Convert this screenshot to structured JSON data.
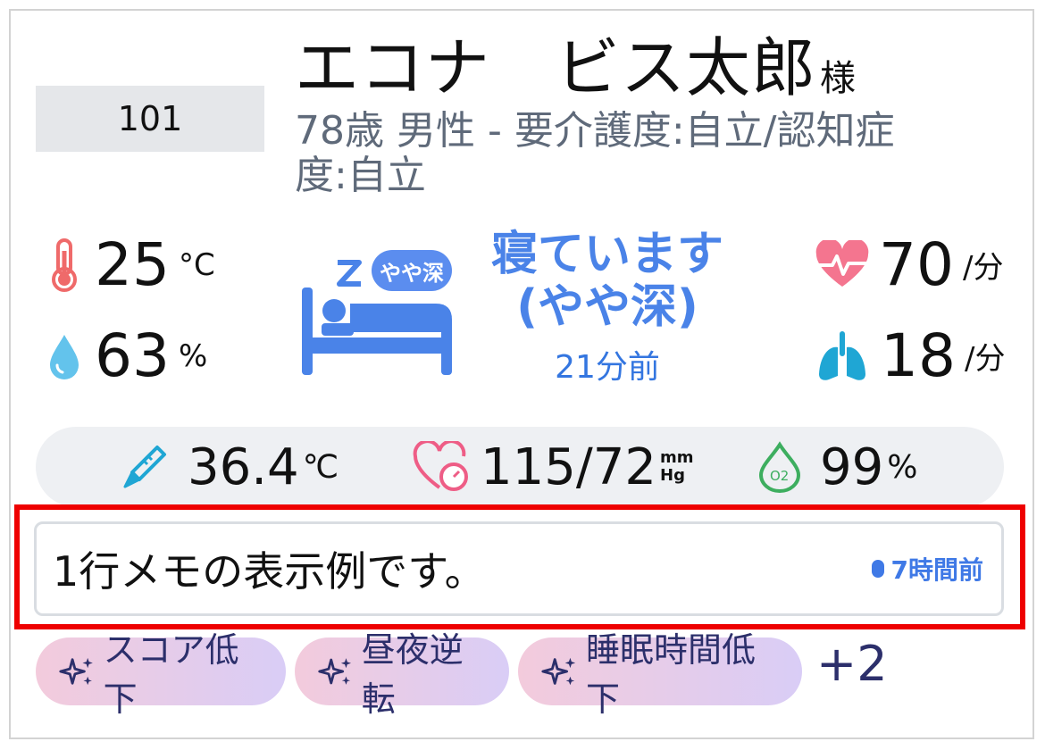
{
  "resident": {
    "room_number": "101",
    "name": "エコナ　ビス太郎",
    "honorific": "様",
    "info_line1": "78歳 男性 - 要介護度:自立/認知症",
    "info_line2": "度:自立"
  },
  "environment": {
    "temperature": {
      "value": "25",
      "unit": "°C",
      "icon": "thermometer-icon"
    },
    "humidity": {
      "value": "63",
      "unit": "%",
      "icon": "water-drop-icon"
    },
    "heart_rate": {
      "value": "70",
      "unit": "/分",
      "icon": "heart-pulse-icon"
    },
    "respiration": {
      "value": "18",
      "unit": "/分",
      "icon": "lungs-icon"
    }
  },
  "sleep": {
    "badge": "やや深",
    "status_line1": "寝ています",
    "status_line2": "(やや深)",
    "elapsed": "21分前",
    "icon": "bed-sleeping-icon",
    "color": "#4a83e8"
  },
  "vitals": {
    "body_temperature": {
      "value": "36.4",
      "unit": "℃"
    },
    "blood_pressure": {
      "value": "115/72",
      "unit_top": "mm",
      "unit_bottom": "Hg"
    },
    "spo2": {
      "value": "99",
      "unit": "%",
      "icon_label": "O2"
    }
  },
  "memo": {
    "text": "1行メモの表示例です。",
    "time": "7時間前"
  },
  "tags": [
    {
      "label": "スコア低下"
    },
    {
      "label": "昼夜逆転"
    },
    {
      "label": "睡眠時間低下"
    }
  ],
  "more_tags": "+2",
  "colors": {
    "accent_blue": "#4a83e8",
    "highlight_red": "#ee0000",
    "thermometer_red": "#ef6a6a",
    "drop_blue": "#63c3ec",
    "heart_pink": "#f4758f",
    "lungs_teal": "#1fa6d4",
    "o2_green": "#3dae5f"
  }
}
